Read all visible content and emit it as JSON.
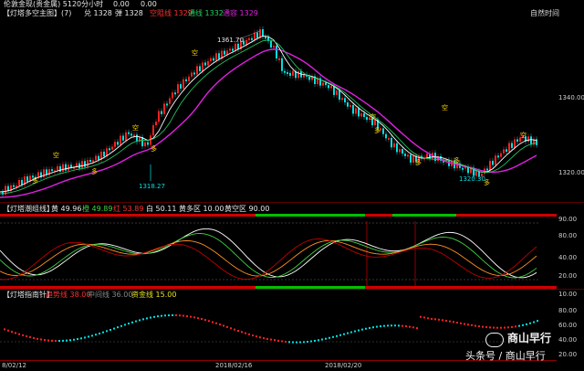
{
  "header": {
    "title": "伦敦金现(贵金属) 5120分小时",
    "price_a": "0.00",
    "price_b": "0.00",
    "right_label": "自然时间"
  },
  "main_panel": {
    "title": "【灯塔多空主图】(7)",
    "buy": "兑 1328",
    "sell": "弹 1328",
    "red_lbl": "空阻线 1329",
    "green_lbl": "通线 1332",
    "mag_lbl": "通容 1329",
    "high_label": "1361.70",
    "low_label_1": "1318.27",
    "low_label_2": "1320.30",
    "y_ticks": [
      "1340.00",
      "1320.00"
    ],
    "signal_buy": "多",
    "signal_sell": "空"
  },
  "osc_panel": {
    "title": "【灯塔潮组线】",
    "v1": "黄 49.96",
    "v2": "橙 49.89",
    "v3": "红 53.89",
    "v4": "白 50.11",
    "v5": "黄多区 10.00",
    "v6": "黄空区 90.00",
    "y_ticks": [
      "90.00",
      "80.00",
      "40.00",
      "20.00",
      "10.00"
    ]
  },
  "trend_panel": {
    "title": "【灯塔指南针】",
    "v1": "趋势线 38.00",
    "v2": "中间线 36.00",
    "v3": "资金线 15.00",
    "y_ticks": [
      "80.00",
      "60.00",
      "40.00",
      "20.00"
    ]
  },
  "x_axis": {
    "labels": [
      "8/02/12",
      "2018/02/16",
      "2018/02/20"
    ]
  },
  "watermark": {
    "line1": "商山早行",
    "line2": "头条号 / 商山早行"
  },
  "colors": {
    "up": "#ff2020",
    "down": "#00e0e0",
    "ma_white": "#ffffff",
    "ma_magenta": "#e020e0",
    "ma_green": "#20c060",
    "axis": "#8b0000"
  }
}
